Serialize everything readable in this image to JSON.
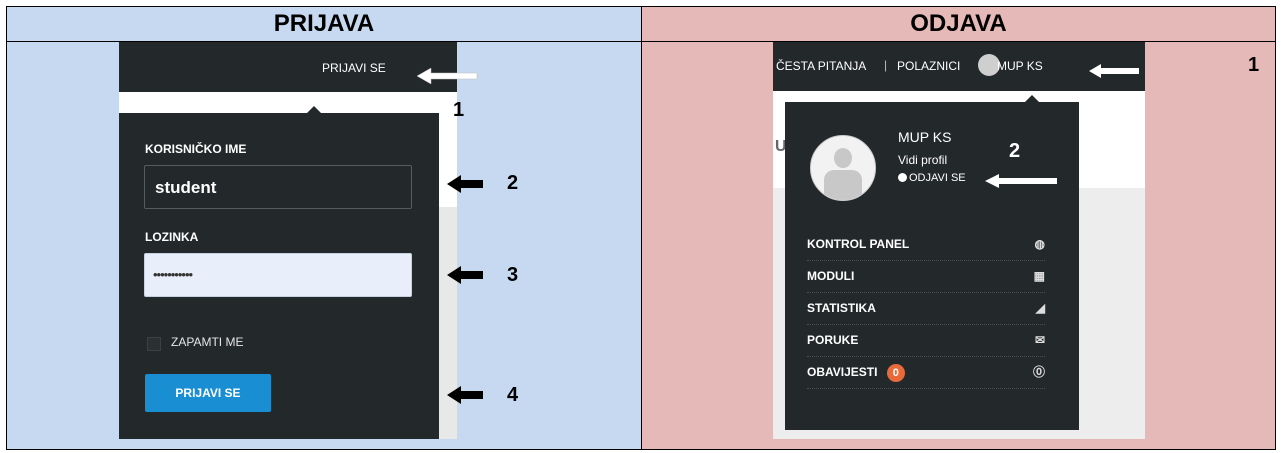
{
  "headers": {
    "left": "PRIJAVA",
    "right": "ODJAVA"
  },
  "login": {
    "topbar_link": "PRIJAVI SE",
    "username_label": "KORISNIČKO IME",
    "username_value": "student",
    "password_label": "LOZINKA",
    "password_value": "•••••••••••",
    "remember_label": "ZAPAMTI ME",
    "submit_label": "PRIJAVI SE",
    "markers": [
      "1",
      "2",
      "3",
      "4"
    ]
  },
  "logout": {
    "topbar": {
      "faq": "ČESTA PITANJA",
      "sep": "|",
      "students": "POLAZNICI",
      "user": "MUP KS"
    },
    "profile_name": "MUP KS",
    "profile_link": "Vidi profil",
    "logout_link": "ODJAVI SE",
    "side_letter": "U",
    "menu": [
      {
        "label": "KONTROL PANEL",
        "icon": "gauge-icon"
      },
      {
        "label": "MODULI",
        "icon": "book-icon"
      },
      {
        "label": "STATISTIKA",
        "icon": "chart-icon"
      },
      {
        "label": "PORUKE",
        "icon": "envelope-icon"
      },
      {
        "label": "OBAVIJESTI",
        "icon": "info-icon"
      }
    ],
    "notifications_count": "0",
    "markers": [
      "1",
      "2"
    ]
  }
}
